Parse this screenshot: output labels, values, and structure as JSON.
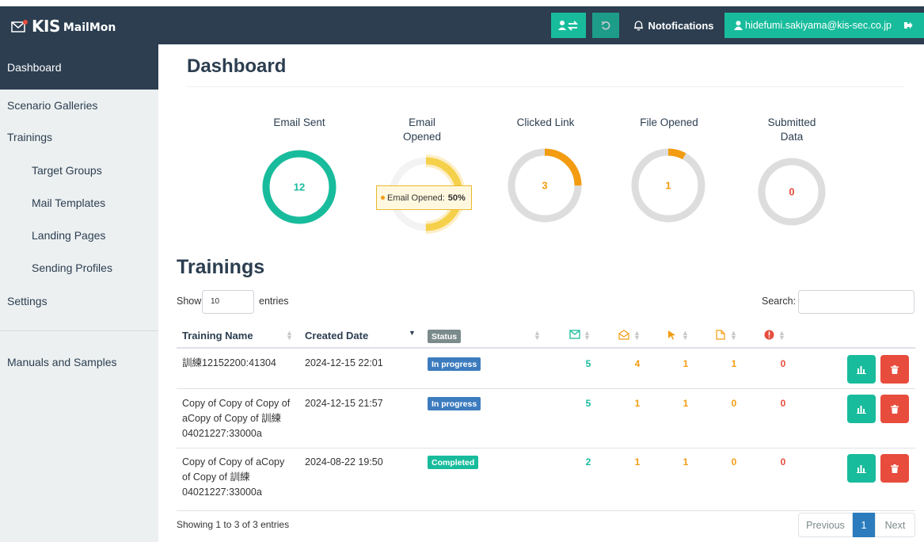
{
  "app": {
    "brand_main": "KIS",
    "brand_sub": "MailMon",
    "notifications_label": "Notofications",
    "user_email": "hidefumi.sakiyama@kis-sec.co.jp"
  },
  "sidebar": {
    "items": [
      {
        "label": "Dashboard",
        "active": true
      },
      {
        "label": "Scenario Galleries"
      },
      {
        "label": "Trainings"
      },
      {
        "label": "Target Groups"
      },
      {
        "label": "Mail Templates"
      },
      {
        "label": "Landing Pages"
      },
      {
        "label": "Sending Profiles"
      },
      {
        "label": "Settings"
      },
      {
        "label": "Manuals and Samples"
      }
    ]
  },
  "page": {
    "title": "Dashboard",
    "section_title": "Trainings"
  },
  "stats": [
    {
      "label_1": "Email Sent",
      "label_2": "",
      "value": "12",
      "percent": 100,
      "color": "#18bc9c"
    },
    {
      "label_1": "Email",
      "label_2": "Opened",
      "value": "",
      "percent": 50,
      "color": "#f5d04a"
    },
    {
      "label_1": "Clicked Link",
      "label_2": "",
      "value": "3",
      "percent": 25,
      "color": "#f39c12"
    },
    {
      "label_1": "File Opened",
      "label_2": "",
      "value": "1",
      "percent": 8,
      "color": "#f39c12"
    },
    {
      "label_1": "Submitted",
      "label_2": "Data",
      "value": "0",
      "percent": 0,
      "color": "#e74c3c"
    }
  ],
  "tooltip": {
    "label": "Email Opened:",
    "value": "50%"
  },
  "table_controls": {
    "show_label": "Show",
    "page_length": "10",
    "entries_label": "entries",
    "search_label": "Search:"
  },
  "table": {
    "headers": {
      "name": "Training Name",
      "created": "Created Date",
      "status": "Status"
    },
    "rows": [
      {
        "name_lines": [
          "訓練12152200:41304",
          "",
          ""
        ],
        "created": "2024-12-15 22:01",
        "status": "In progress",
        "sent": "5",
        "opened": "4",
        "clicked": "1",
        "file": "1",
        "submitted": "0"
      },
      {
        "name_lines": [
          "Copy of Copy of Copy of",
          "aCopy of Copy of 訓練",
          "04021227:33000a"
        ],
        "created": "2024-12-15 21:57",
        "status": "In progress",
        "sent": "5",
        "opened": "1",
        "clicked": "1",
        "file": "0",
        "submitted": "0"
      },
      {
        "name_lines": [
          "Copy of Copy of aCopy",
          "of Copy of 訓練",
          "04021227:33000a"
        ],
        "created": "2024-08-22 19:50",
        "status": "Completed",
        "sent": "2",
        "opened": "1",
        "clicked": "1",
        "file": "0",
        "submitted": "0"
      }
    ]
  },
  "footer": {
    "info": "Showing 1 to 3 of 3 entries",
    "previous": "Previous",
    "current_page": "1",
    "next": "Next"
  },
  "colors": {
    "navy": "#2c3e50",
    "teal": "#18bc9c",
    "orange": "#f39c12",
    "red": "#e74c3c",
    "blue": "#3c7cbe"
  }
}
